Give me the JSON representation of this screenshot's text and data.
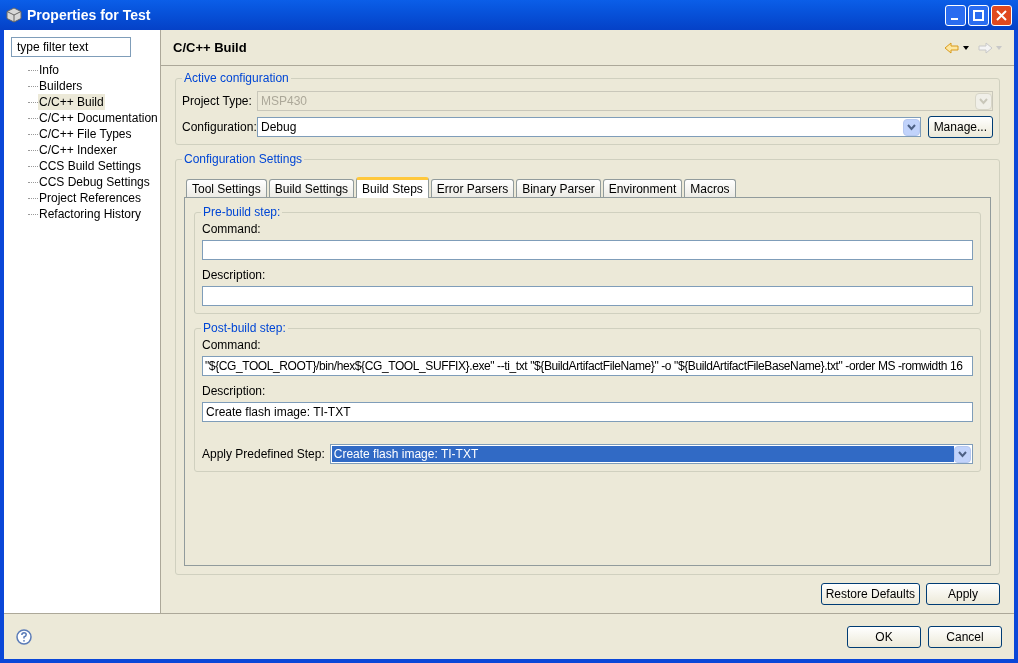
{
  "window": {
    "title": "Properties for Test"
  },
  "sidebar": {
    "filter": {
      "placeholder": "type filter text"
    },
    "items": [
      {
        "label": "Info",
        "selected": false
      },
      {
        "label": "Builders",
        "selected": false
      },
      {
        "label": "C/C++ Build",
        "selected": true
      },
      {
        "label": "C/C++ Documentation",
        "selected": false
      },
      {
        "label": "C/C++ File Types",
        "selected": false
      },
      {
        "label": "C/C++ Indexer",
        "selected": false
      },
      {
        "label": "CCS Build Settings",
        "selected": false
      },
      {
        "label": "CCS Debug Settings",
        "selected": false
      },
      {
        "label": "Project References",
        "selected": false
      },
      {
        "label": "Refactoring History",
        "selected": false
      }
    ]
  },
  "page": {
    "title": "C/C++ Build"
  },
  "active_configuration": {
    "title": "Active configuration",
    "project_type": {
      "label": "Project Type:",
      "value": "MSP430",
      "disabled": true
    },
    "configuration": {
      "label": "Configuration:",
      "value": "Debug"
    },
    "manage_button": "Manage..."
  },
  "configuration_settings": {
    "title": "Configuration Settings",
    "tabs": [
      {
        "label": "Tool Settings",
        "selected": false
      },
      {
        "label": "Build Settings",
        "selected": false
      },
      {
        "label": "Build Steps",
        "selected": true
      },
      {
        "label": "Error Parsers",
        "selected": false
      },
      {
        "label": "Binary Parser",
        "selected": false
      },
      {
        "label": "Environment",
        "selected": false
      },
      {
        "label": "Macros",
        "selected": false
      }
    ]
  },
  "pre_build": {
    "title": "Pre-build step:",
    "command_label": "Command:",
    "description_label": "Description:"
  },
  "post_build": {
    "title": "Post-build step:",
    "command_label": "Command:",
    "command": "\"${CG_TOOL_ROOT}/bin/hex${CG_TOOL_SUFFIX}.exe\" --ti_txt \"${BuildArtifactFileName}\" -o \"${BuildArtifactFileBaseName}.txt\" -order MS -romwidth 16",
    "description_label": "Description:",
    "description": "Create flash image: TI-TXT",
    "predefined_label": "Apply Predefined Step:",
    "predefined": "Create flash image: TI-TXT"
  },
  "page_buttons": [
    "Restore Defaults",
    "Apply"
  ],
  "dialog_buttons": [
    "OK",
    "Cancel"
  ]
}
